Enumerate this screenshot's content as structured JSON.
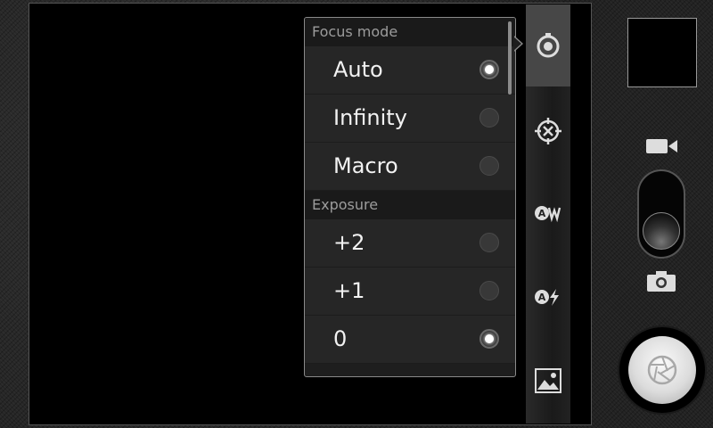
{
  "popup": {
    "sections": [
      {
        "header": "Focus mode",
        "options": [
          {
            "label": "Auto",
            "checked": true
          },
          {
            "label": "Infinity",
            "checked": false
          },
          {
            "label": "Macro",
            "checked": false
          }
        ]
      },
      {
        "header": "Exposure",
        "options": [
          {
            "label": "+2",
            "checked": false
          },
          {
            "label": "+1",
            "checked": false
          },
          {
            "label": "0",
            "checked": true
          }
        ]
      }
    ]
  },
  "side_strip": {
    "icons": [
      "settings-icon",
      "focus-icon",
      "white-balance-icon",
      "flash-icon",
      "scene-icon"
    ],
    "active": "settings-icon"
  },
  "mode_switch": {
    "selected": "camera",
    "options": [
      "video",
      "camera"
    ]
  },
  "colors": {
    "accent": "#ffffff",
    "popup_bg": "#262626",
    "border": "#8a8a8a"
  }
}
